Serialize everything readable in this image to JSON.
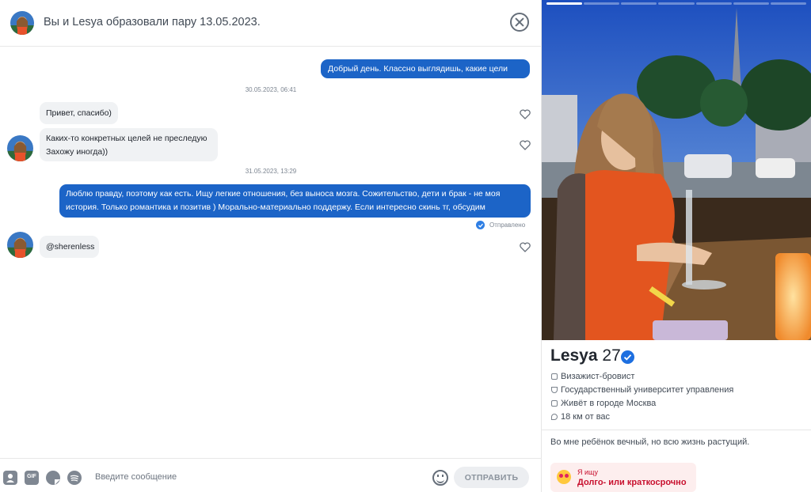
{
  "header": {
    "title": "Вы и Lesya образовали пару 13.05.2023."
  },
  "messages": [
    {
      "type": "out",
      "text": "Добрый день. Классно выглядишь, какие цели тут?"
    },
    {
      "type": "timestamp",
      "text": "30.05.2023, 06:41"
    },
    {
      "type": "in",
      "text": "Привет, спасибо)"
    },
    {
      "type": "in",
      "lines": [
        "Каких-то конкретных целей не преследую",
        "Захожу иногда))"
      ]
    },
    {
      "type": "timestamp",
      "text": "31.05.2023, 13:29"
    },
    {
      "type": "out",
      "lines": [
        "Люблю правду, поэтому как есть. Ищу легкие отношения, без выноса мозга. Сожительство, дети и брак - не моя",
        "история. Только романтика и позитив ) Морально-материально поддержу. Если интересно скинь тг, обсудим"
      ]
    },
    {
      "type": "status",
      "text": "Отправлено"
    },
    {
      "type": "in",
      "text": "@sherenless"
    }
  ],
  "composer": {
    "placeholder": "Введите сообщение",
    "gif_label": "GIF",
    "send_label": "ОТПРАВИТЬ",
    "tools": [
      "contact-card-icon",
      "gif-icon",
      "sticker-icon",
      "spotify-icon"
    ]
  },
  "profile": {
    "name": "Lesya",
    "age": "27",
    "verified": true,
    "job": "Визажист-бровист",
    "school": "Государственный университет управления",
    "city": "Живёт в городе Москва",
    "distance": "18 км от вас",
    "bio": "Во мне ребёнок вечный, но всю жизнь растущий.",
    "looking_for_label": "Я ищу",
    "looking_for_value": "Долго- или краткосрочно",
    "photo_count": 7,
    "photo_index": 1
  },
  "colors": {
    "accent": "#1c64c7",
    "incoming_bubble": "#f0f2f4",
    "seek_text": "#c8102e"
  }
}
